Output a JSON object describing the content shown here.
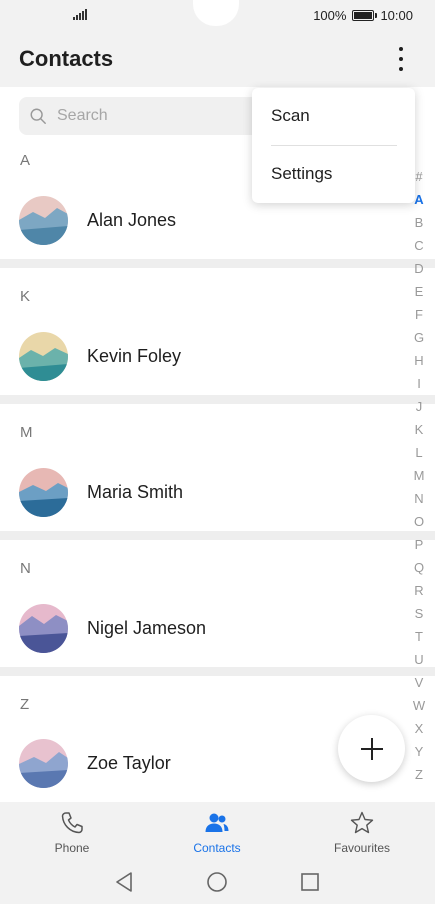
{
  "status_bar": {
    "battery": "100%",
    "time": "10:00"
  },
  "header": {
    "title": "Contacts"
  },
  "search": {
    "placeholder": "Search"
  },
  "menu": {
    "items": [
      {
        "label": "Scan"
      },
      {
        "label": "Settings"
      }
    ]
  },
  "sections": [
    {
      "letter": "A",
      "name": "Alan Jones"
    },
    {
      "letter": "K",
      "name": "Kevin Foley"
    },
    {
      "letter": "M",
      "name": "Maria Smith"
    },
    {
      "letter": "N",
      "name": "Nigel Jameson"
    },
    {
      "letter": "Z",
      "name": "Zoe Taylor"
    }
  ],
  "index": {
    "letters": [
      "#",
      "A",
      "B",
      "C",
      "D",
      "E",
      "F",
      "G",
      "H",
      "I",
      "J",
      "K",
      "L",
      "M",
      "N",
      "O",
      "P",
      "Q",
      "R",
      "S",
      "T",
      "U",
      "V",
      "W",
      "X",
      "Y",
      "Z"
    ],
    "active": "A"
  },
  "bottom_nav": {
    "items": [
      {
        "label": "Phone",
        "icon": "phone-icon"
      },
      {
        "label": "Contacts",
        "icon": "contacts-icon",
        "active": true
      },
      {
        "label": "Favourites",
        "icon": "star-icon"
      }
    ]
  },
  "colors": {
    "accent": "#1a73e8",
    "bar_background": "#f2f2f2"
  }
}
